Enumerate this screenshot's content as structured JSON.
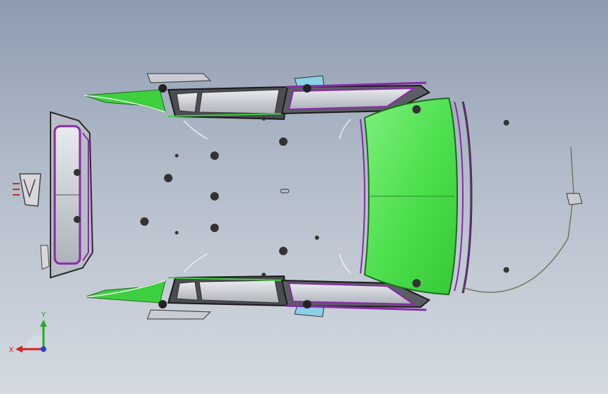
{
  "viewport": {
    "colors": {
      "background_top": "#8e9cb1",
      "background_bottom": "#d5dae1",
      "glass_green": "#4fe04f",
      "panel_green": "#3ecf3e",
      "trim_purple": "#8a2aa8",
      "frame_dark": "#2a2a2a",
      "glass_grey": "#c8cbd0"
    }
  },
  "triad": {
    "x_label": "X",
    "y_label": "Y",
    "x_color": "#d82020",
    "y_color": "#2aa82a",
    "z_color": "#2040e0"
  },
  "model": {
    "name_icon": "car-body-wireframe"
  }
}
